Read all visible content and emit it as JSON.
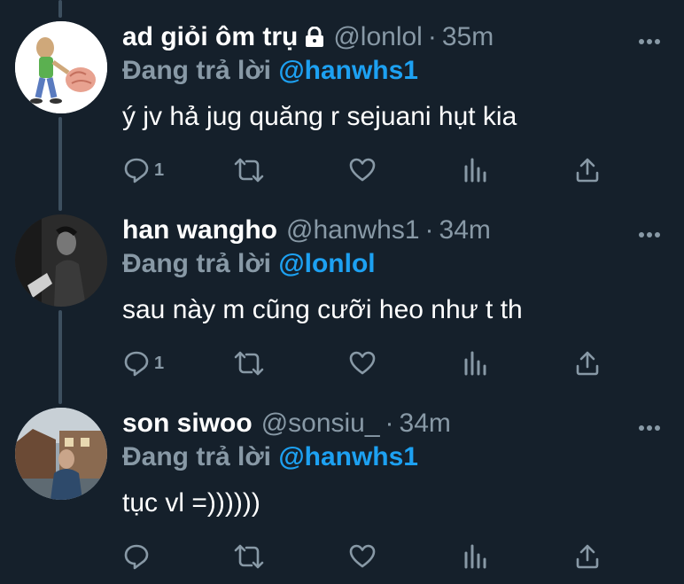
{
  "tweets": [
    {
      "display_name": "ad giỏi ôm trụ",
      "handle": "@lonlol",
      "separator": "·",
      "time": "35m",
      "reply_prefix": "Đang trả lời",
      "reply_target": "@hanwhs1",
      "text": "ý jv hả jug quăng r sejuani hụt kia",
      "reply_count": "1",
      "locked": true
    },
    {
      "display_name": "han wangho",
      "handle": "@hanwhs1",
      "separator": "·",
      "time": "34m",
      "reply_prefix": "Đang trả lời",
      "reply_target": "@lonlol",
      "text": "sau này m cũng cưỡi heo như t th",
      "reply_count": "1",
      "locked": false
    },
    {
      "display_name": "son siwoo",
      "handle": "@sonsiu_",
      "separator": "·",
      "time": "34m",
      "reply_prefix": "Đang trả lời",
      "reply_target": "@hanwhs1",
      "text": "tục vl =))))))",
      "reply_count": "",
      "locked": false
    }
  ],
  "icons": {
    "reply": "reply-icon",
    "retweet": "retweet-icon",
    "like": "heart-icon",
    "analytics": "analytics-icon",
    "share": "share-icon",
    "more": "more-icon",
    "lock": "lock-icon"
  },
  "colors": {
    "background": "#15202b",
    "text": "#ffffff",
    "muted": "#8899a6",
    "link": "#1da1f2",
    "thread_line": "#3d4f5f"
  }
}
